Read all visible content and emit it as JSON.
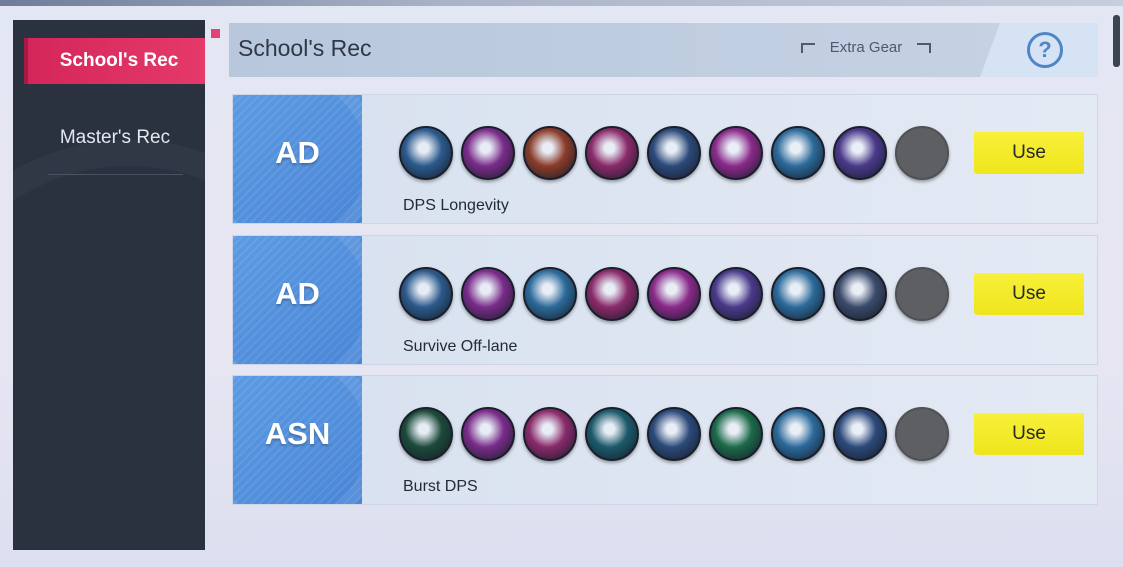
{
  "sidebar": {
    "active_tab": "School's Rec",
    "items": [
      {
        "label": "Master's Rec"
      }
    ]
  },
  "header": {
    "title": "School's Rec",
    "extra_gear": "Extra Gear",
    "help": "?"
  },
  "builds": [
    {
      "role": "AD",
      "name": "DPS Longevity",
      "items": [
        {
          "icon": "blade-icon",
          "color": "#2c5a8c"
        },
        {
          "icon": "spiked-armor-icon",
          "color": "#7a2c8a"
        },
        {
          "icon": "golden-armor-icon",
          "color": "#8a3c2a"
        },
        {
          "icon": "crimson-armor-icon",
          "color": "#8a2a6a"
        },
        {
          "icon": "helmet-icon",
          "color": "#2c4a7a"
        },
        {
          "icon": "gold-helmet-icon",
          "color": "#8a2a8a"
        },
        {
          "icon": "card-icon",
          "color": "#2c6a9a"
        },
        {
          "icon": "cat-icon",
          "color": "#4a3a8a"
        },
        {
          "icon": "empty-slot",
          "color": "#5d5f62"
        }
      ],
      "use_label": "Use"
    },
    {
      "role": "AD",
      "name": "Survive Off-lane",
      "items": [
        {
          "icon": "blade-icon",
          "color": "#2c5a8c"
        },
        {
          "icon": "spiked-armor-icon",
          "color": "#7a2c8a"
        },
        {
          "icon": "ice-armor-icon",
          "color": "#2c6a9a"
        },
        {
          "icon": "crimson-armor-icon",
          "color": "#8a2a6a"
        },
        {
          "icon": "gold-helmet-icon",
          "color": "#8a2a8a"
        },
        {
          "icon": "cat-icon",
          "color": "#4a3a8a"
        },
        {
          "icon": "card-icon",
          "color": "#2c6a9a"
        },
        {
          "icon": "red-arrows-icon",
          "color": "#3a4a6a"
        },
        {
          "icon": "empty-slot",
          "color": "#5d5f62"
        }
      ],
      "use_label": "Use"
    },
    {
      "role": "ASN",
      "name": "Burst DPS",
      "items": [
        {
          "icon": "green-boots-icon",
          "color": "#1c4a3a"
        },
        {
          "icon": "spiked-armor-icon",
          "color": "#7a2c8a"
        },
        {
          "icon": "crimson-armor-icon",
          "color": "#8a2a6a"
        },
        {
          "icon": "teal-gauntlet-icon",
          "color": "#1c5a6a"
        },
        {
          "icon": "gold-scroll-icon",
          "color": "#2c4a7a"
        },
        {
          "icon": "green-gem-icon",
          "color": "#1c6a4a"
        },
        {
          "icon": "card-icon",
          "color": "#2c6a9a"
        },
        {
          "icon": "helmet-icon",
          "color": "#2c4a7a"
        },
        {
          "icon": "empty-slot",
          "color": "#5d5f62"
        }
      ],
      "use_label": "Use"
    }
  ]
}
